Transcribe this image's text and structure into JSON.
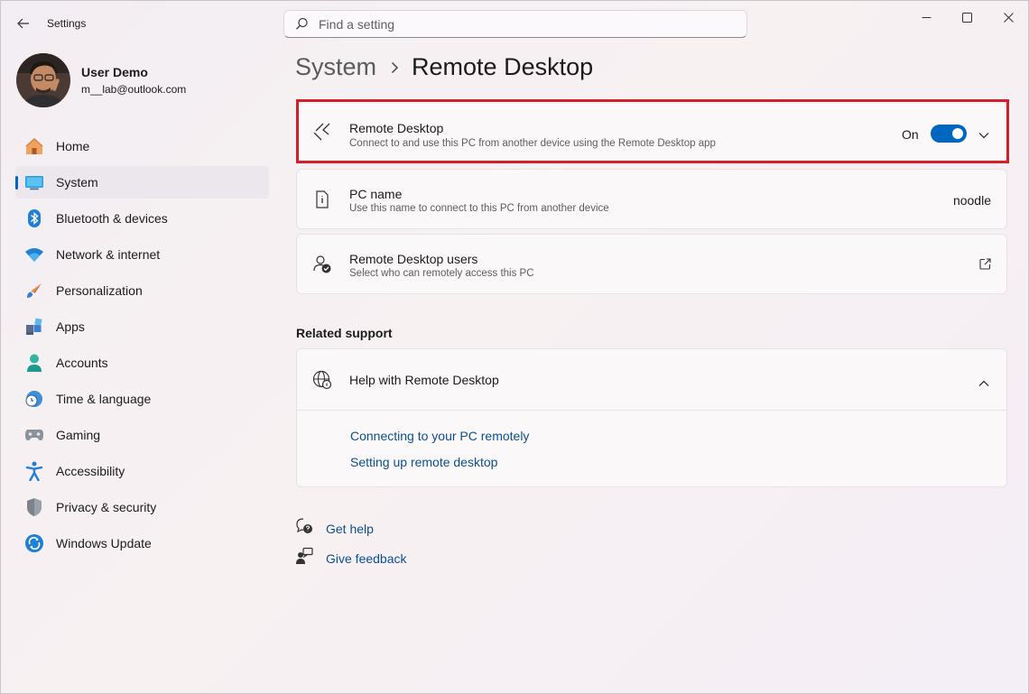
{
  "titlebar": {
    "app_title": "Settings",
    "search_placeholder": "Find a setting",
    "back_icon": "back-arrow-icon",
    "controls": [
      "minimize-icon",
      "maximize-icon",
      "close-icon"
    ]
  },
  "profile": {
    "name": "User Demo",
    "email": "m__lab@outlook.com"
  },
  "nav": {
    "items": [
      {
        "label": "Home",
        "icon": "home-icon"
      },
      {
        "label": "System",
        "icon": "system-icon",
        "active": true
      },
      {
        "label": "Bluetooth & devices",
        "icon": "bluetooth-icon"
      },
      {
        "label": "Network & internet",
        "icon": "wifi-icon"
      },
      {
        "label": "Personalization",
        "icon": "brush-icon"
      },
      {
        "label": "Apps",
        "icon": "apps-icon"
      },
      {
        "label": "Accounts",
        "icon": "account-icon"
      },
      {
        "label": "Time & language",
        "icon": "clock-globe-icon"
      },
      {
        "label": "Gaming",
        "icon": "gamepad-icon"
      },
      {
        "label": "Accessibility",
        "icon": "accessibility-icon"
      },
      {
        "label": "Privacy & security",
        "icon": "shield-icon"
      },
      {
        "label": "Windows Update",
        "icon": "update-icon"
      }
    ]
  },
  "breadcrumb": {
    "parent": "System",
    "current": "Remote Desktop"
  },
  "cards": {
    "remote_desktop": {
      "title": "Remote Desktop",
      "description": "Connect to and use this PC from another device using the Remote Desktop app",
      "state_label": "On",
      "enabled": true
    },
    "pc_name": {
      "title": "PC name",
      "description": "Use this name to connect to this PC from another device",
      "value": "noodle"
    },
    "users": {
      "title": "Remote Desktop users",
      "description": "Select who can remotely access this PC"
    }
  },
  "related_support": {
    "heading": "Related support",
    "help_title": "Help with Remote Desktop",
    "links": [
      "Connecting to your PC remotely",
      "Setting up remote desktop"
    ]
  },
  "footer": {
    "get_help": "Get help",
    "give_feedback": "Give feedback"
  },
  "colors": {
    "accent": "#0067c0",
    "highlight": "#d41f2b",
    "link": "#0b4f8f"
  }
}
